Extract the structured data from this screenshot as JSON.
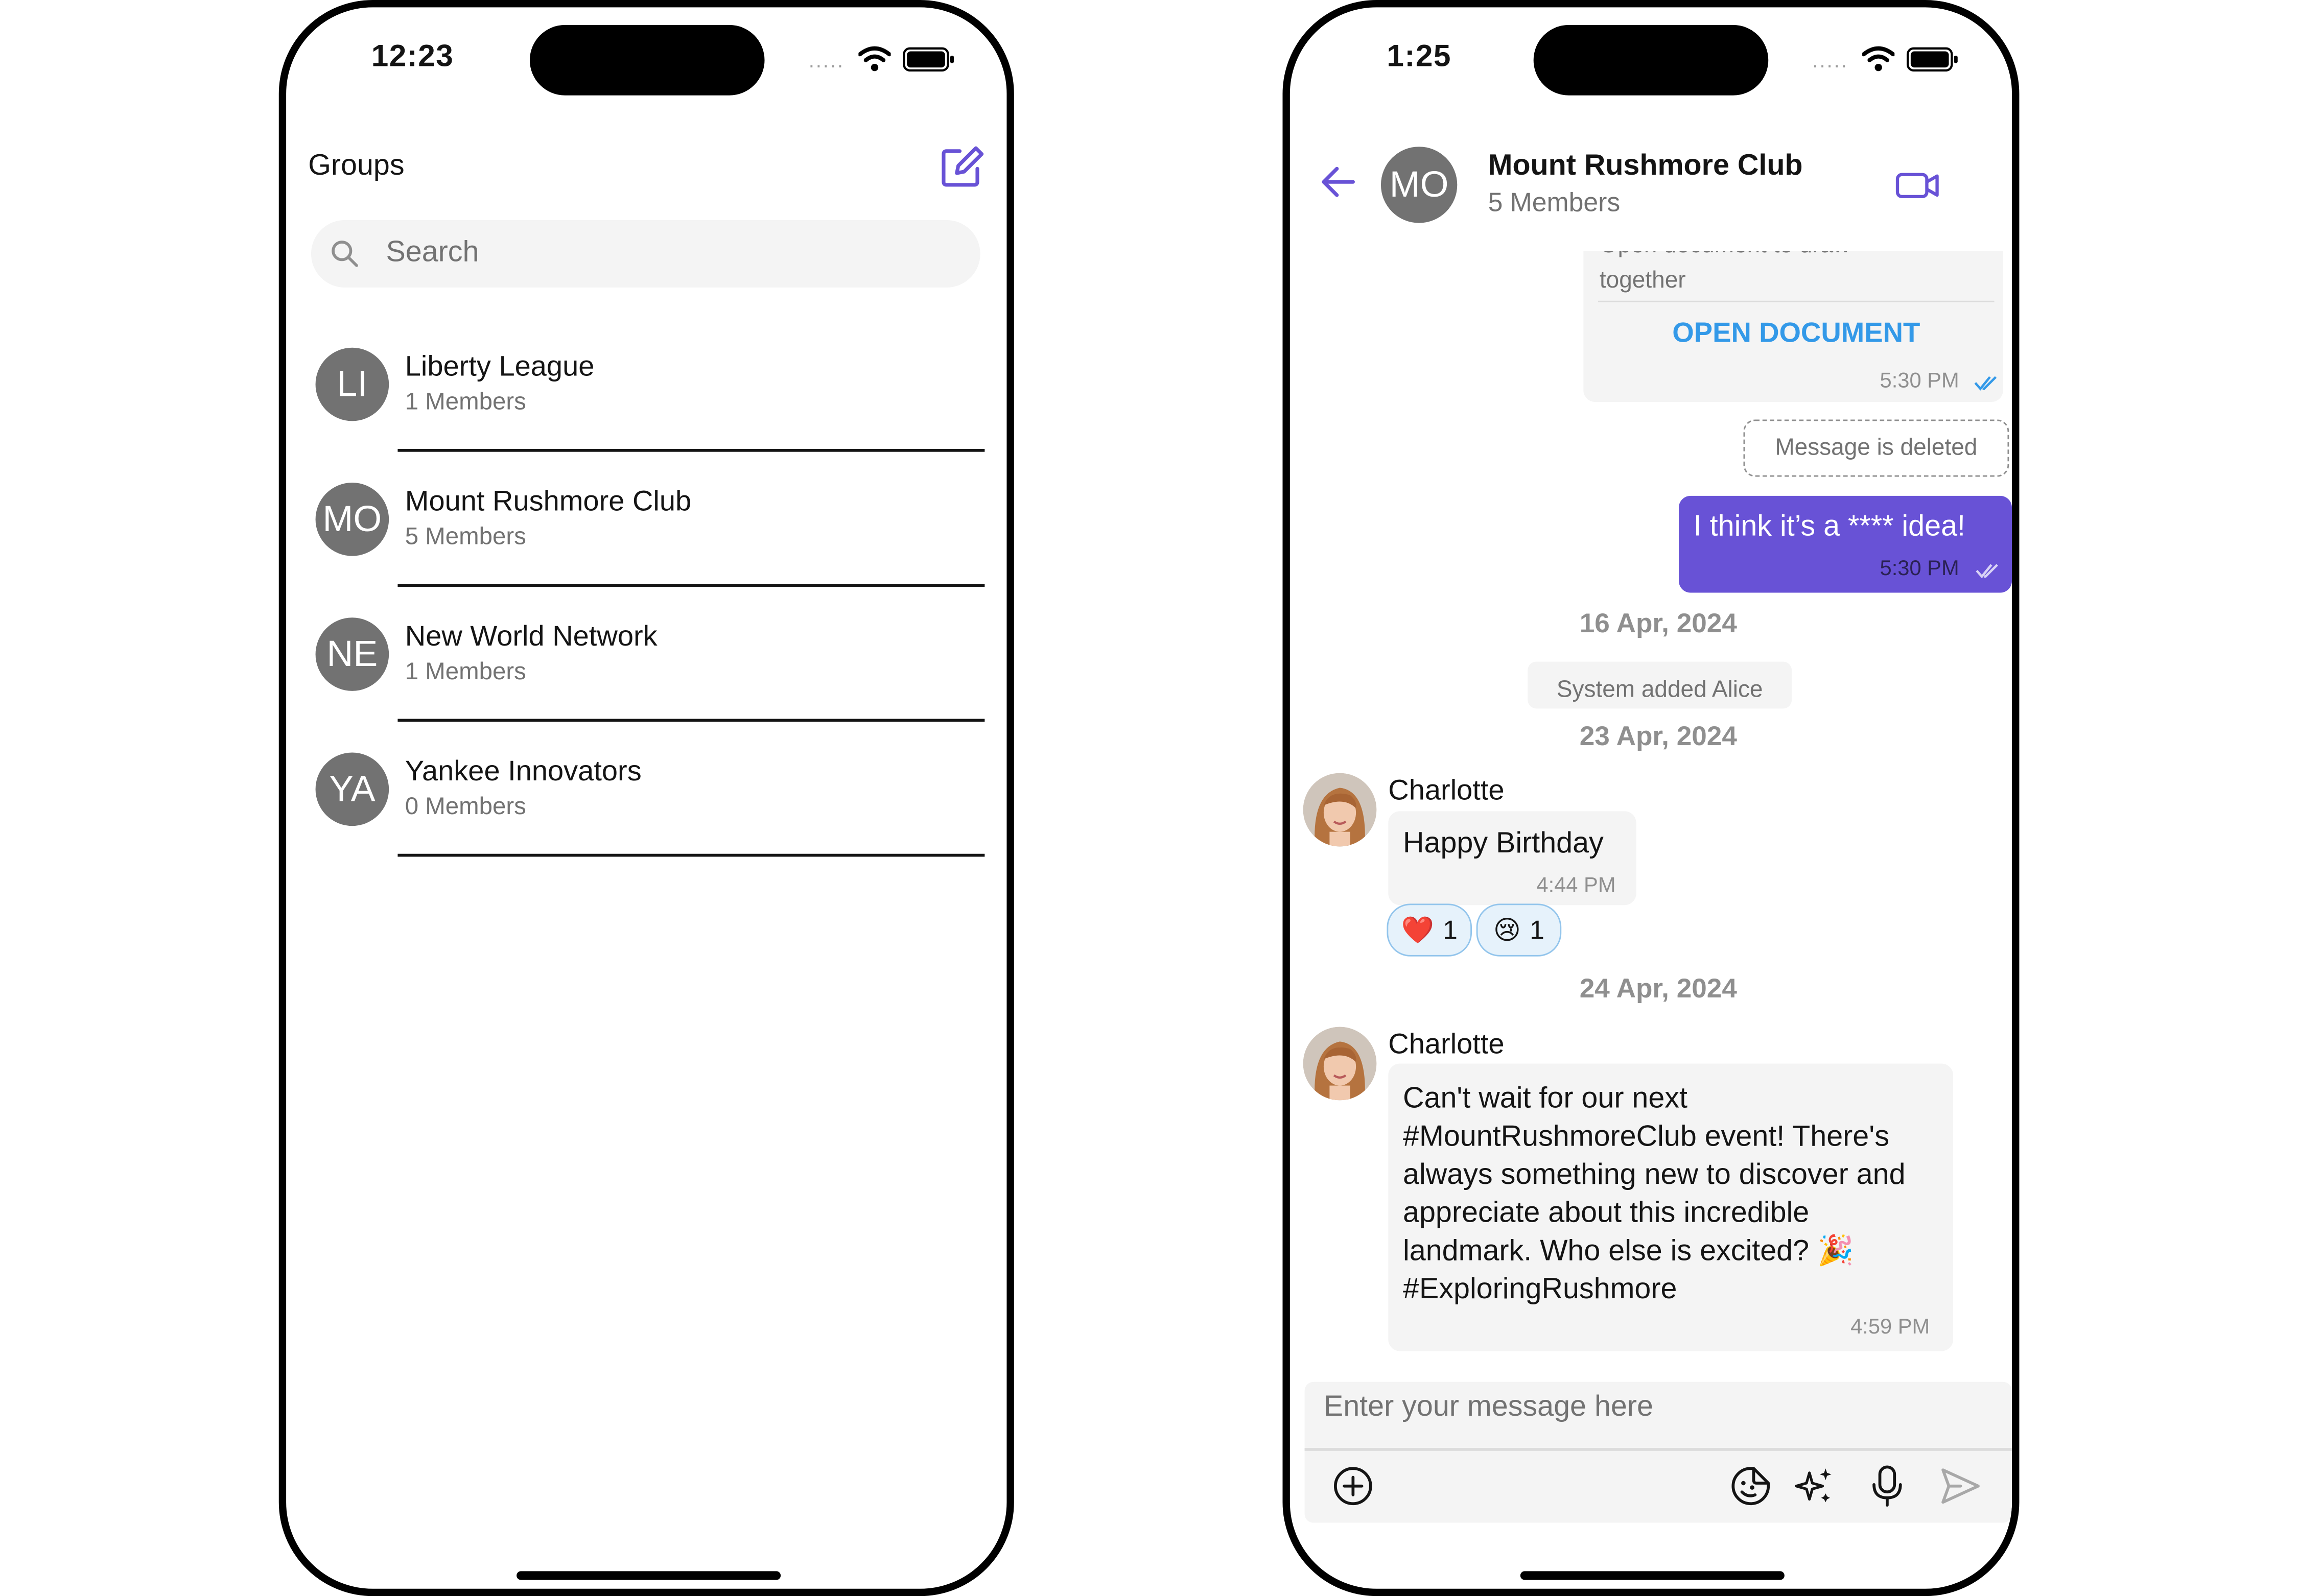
{
  "left_screen": {
    "status": {
      "time": "12:23",
      "signal": "....."
    },
    "header": {
      "title": "Groups"
    },
    "search": {
      "placeholder": "Search"
    },
    "groups": [
      {
        "initials": "LI",
        "name": "Liberty League",
        "members": "1 Members"
      },
      {
        "initials": "MO",
        "name": "Mount Rushmore Club",
        "members": "5 Members"
      },
      {
        "initials": "NE",
        "name": "New World Network",
        "members": "1 Members"
      },
      {
        "initials": "YA",
        "name": "Yankee Innovators",
        "members": "0 Members"
      }
    ]
  },
  "right_screen": {
    "status": {
      "time": "1:25",
      "signal": "....."
    },
    "header": {
      "initials": "MO",
      "title": "Mount Rushmore Club",
      "subtitle": "5 Members"
    },
    "messages": {
      "document_card": {
        "text_partial": "Open document to draw",
        "text_line2": "together",
        "button": "OPEN DOCUMENT",
        "time": "5:30 PM"
      },
      "deleted": {
        "text": "Message is deleted"
      },
      "outgoing": {
        "text": "I think it’s a **** idea!",
        "time": "5:30 PM"
      },
      "date1": "16 Apr, 2024",
      "system": "System added Alice",
      "date2": "23 Apr, 2024",
      "msg1": {
        "sender": "Charlotte",
        "text": "Happy Birthday",
        "time": "4:44 PM",
        "reactions": [
          {
            "emoji": "❤️",
            "count": "1"
          },
          {
            "emoji": "😢",
            "count": "1"
          }
        ]
      },
      "date3": "24 Apr, 2024",
      "msg2": {
        "sender": "Charlotte",
        "text": "Can't wait for our next #MountRushmoreClub event! There's always something new to discover and appreciate about this incredible landmark. Who else is excited? 🎉 #ExploringRushmore",
        "time": "4:59 PM"
      }
    },
    "composer": {
      "placeholder": "Enter your message here"
    }
  },
  "colors": {
    "accent": "#6852D6",
    "link": "#3399E8",
    "bubble_in": "#F4F4F4",
    "muted": "#727272"
  }
}
